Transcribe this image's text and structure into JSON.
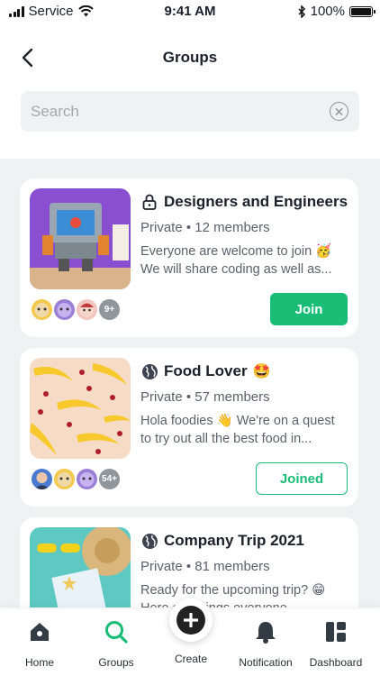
{
  "status_bar": {
    "carrier": "Service",
    "time": "9:41 AM",
    "battery": "100%"
  },
  "header": {
    "title": "Groups"
  },
  "search": {
    "placeholder": "Search",
    "value": ""
  },
  "groups": [
    {
      "name": "Designers and Engineers",
      "privacy_icon": "lock-icon",
      "emoji": "",
      "meta": "Private • 12 members",
      "description": "Everyone are welcome to join 🥳 We will share coding as well as...",
      "more_members": "9+",
      "action": "Join",
      "action_style": "primary"
    },
    {
      "name": "Food Lover",
      "privacy_icon": "globe-icon",
      "emoji": "🤩",
      "meta": "Private • 57 members",
      "description": "Hola foodies 👋 We're on a quest to try out all the best food in...",
      "more_members": "54+",
      "action": "Joined",
      "action_style": "outline"
    },
    {
      "name": "Company Trip 2021",
      "privacy_icon": "globe-icon",
      "emoji": "",
      "meta": "Private • 81 members",
      "description": "Ready for the upcoming trip? 😁 Here are things everyone...",
      "more_members": "",
      "action": "",
      "action_style": ""
    }
  ],
  "tabbar": {
    "tabs": [
      {
        "label": "Home",
        "icon": "home-icon"
      },
      {
        "label": "Groups",
        "icon": "search-icon",
        "active": true
      },
      {
        "label": "Create",
        "icon": "plus-icon"
      },
      {
        "label": "Notification",
        "icon": "bell-icon"
      },
      {
        "label": "Dashboard",
        "icon": "dashboard-icon"
      }
    ]
  },
  "colors": {
    "accent": "#19bd76",
    "background": "#eef2f3",
    "text": "#1d1f2a",
    "muted": "#5b616b"
  }
}
